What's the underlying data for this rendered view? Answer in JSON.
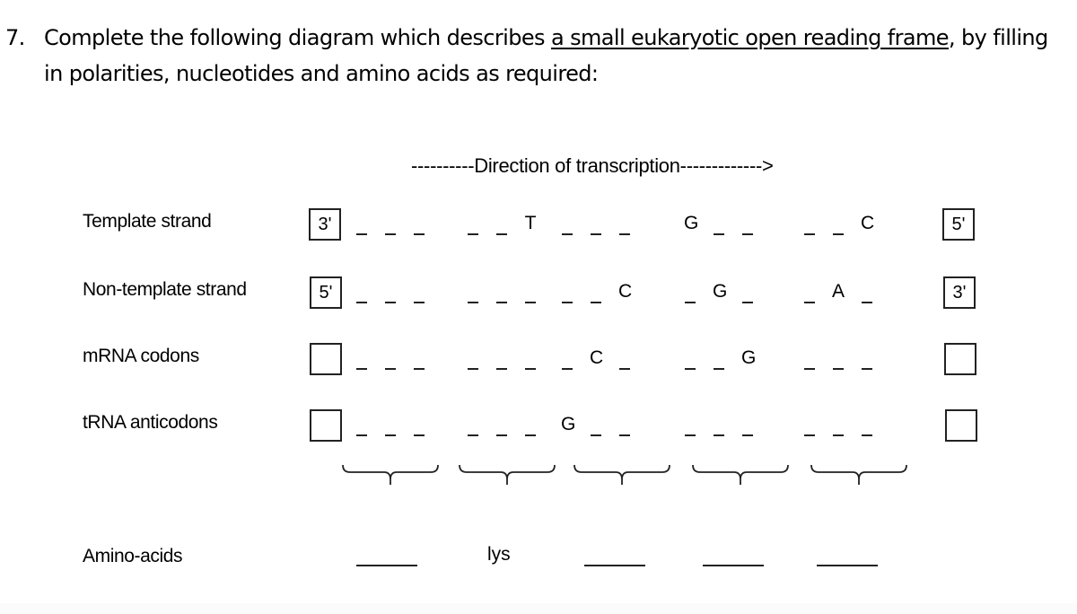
{
  "question": {
    "number": "7.",
    "line1_before": "Complete the following diagram which describes ",
    "line1_underlined": "a small eukaryotic open reading frame",
    "line1_after": ", by filling",
    "line2": "in polarities, nucleotides and amino acids as required:"
  },
  "direction_label": "----------Direction of transcription------------->",
  "rows": [
    {
      "label": "Template strand",
      "left_polarity": "3'",
      "right_polarity": "5'",
      "nucleotides": [
        "",
        "",
        "",
        "",
        "",
        "T",
        "",
        "",
        "",
        "G",
        "",
        "",
        "",
        "",
        "C"
      ]
    },
    {
      "label": "Non-template strand",
      "left_polarity": "5'",
      "right_polarity": "3'",
      "nucleotides": [
        "",
        "",
        "",
        "",
        "",
        "",
        "",
        "",
        "C",
        "",
        "G",
        "",
        "",
        "A",
        ""
      ]
    },
    {
      "label": "mRNA codons",
      "left_polarity": "",
      "right_polarity": "",
      "nucleotides": [
        "",
        "",
        "",
        "",
        "",
        "",
        "",
        "C",
        "",
        "",
        "",
        "G",
        "",
        "",
        ""
      ]
    },
    {
      "label": "tRNA anticodons",
      "left_polarity": "",
      "right_polarity": "",
      "nucleotides": [
        "",
        "",
        "",
        "",
        "",
        "",
        "G",
        "",
        "",
        "",
        "",
        "",
        "",
        "",
        ""
      ]
    }
  ],
  "amino_acids": {
    "label": "Amino-acids",
    "values": [
      "",
      "lys",
      "",
      "",
      ""
    ]
  }
}
